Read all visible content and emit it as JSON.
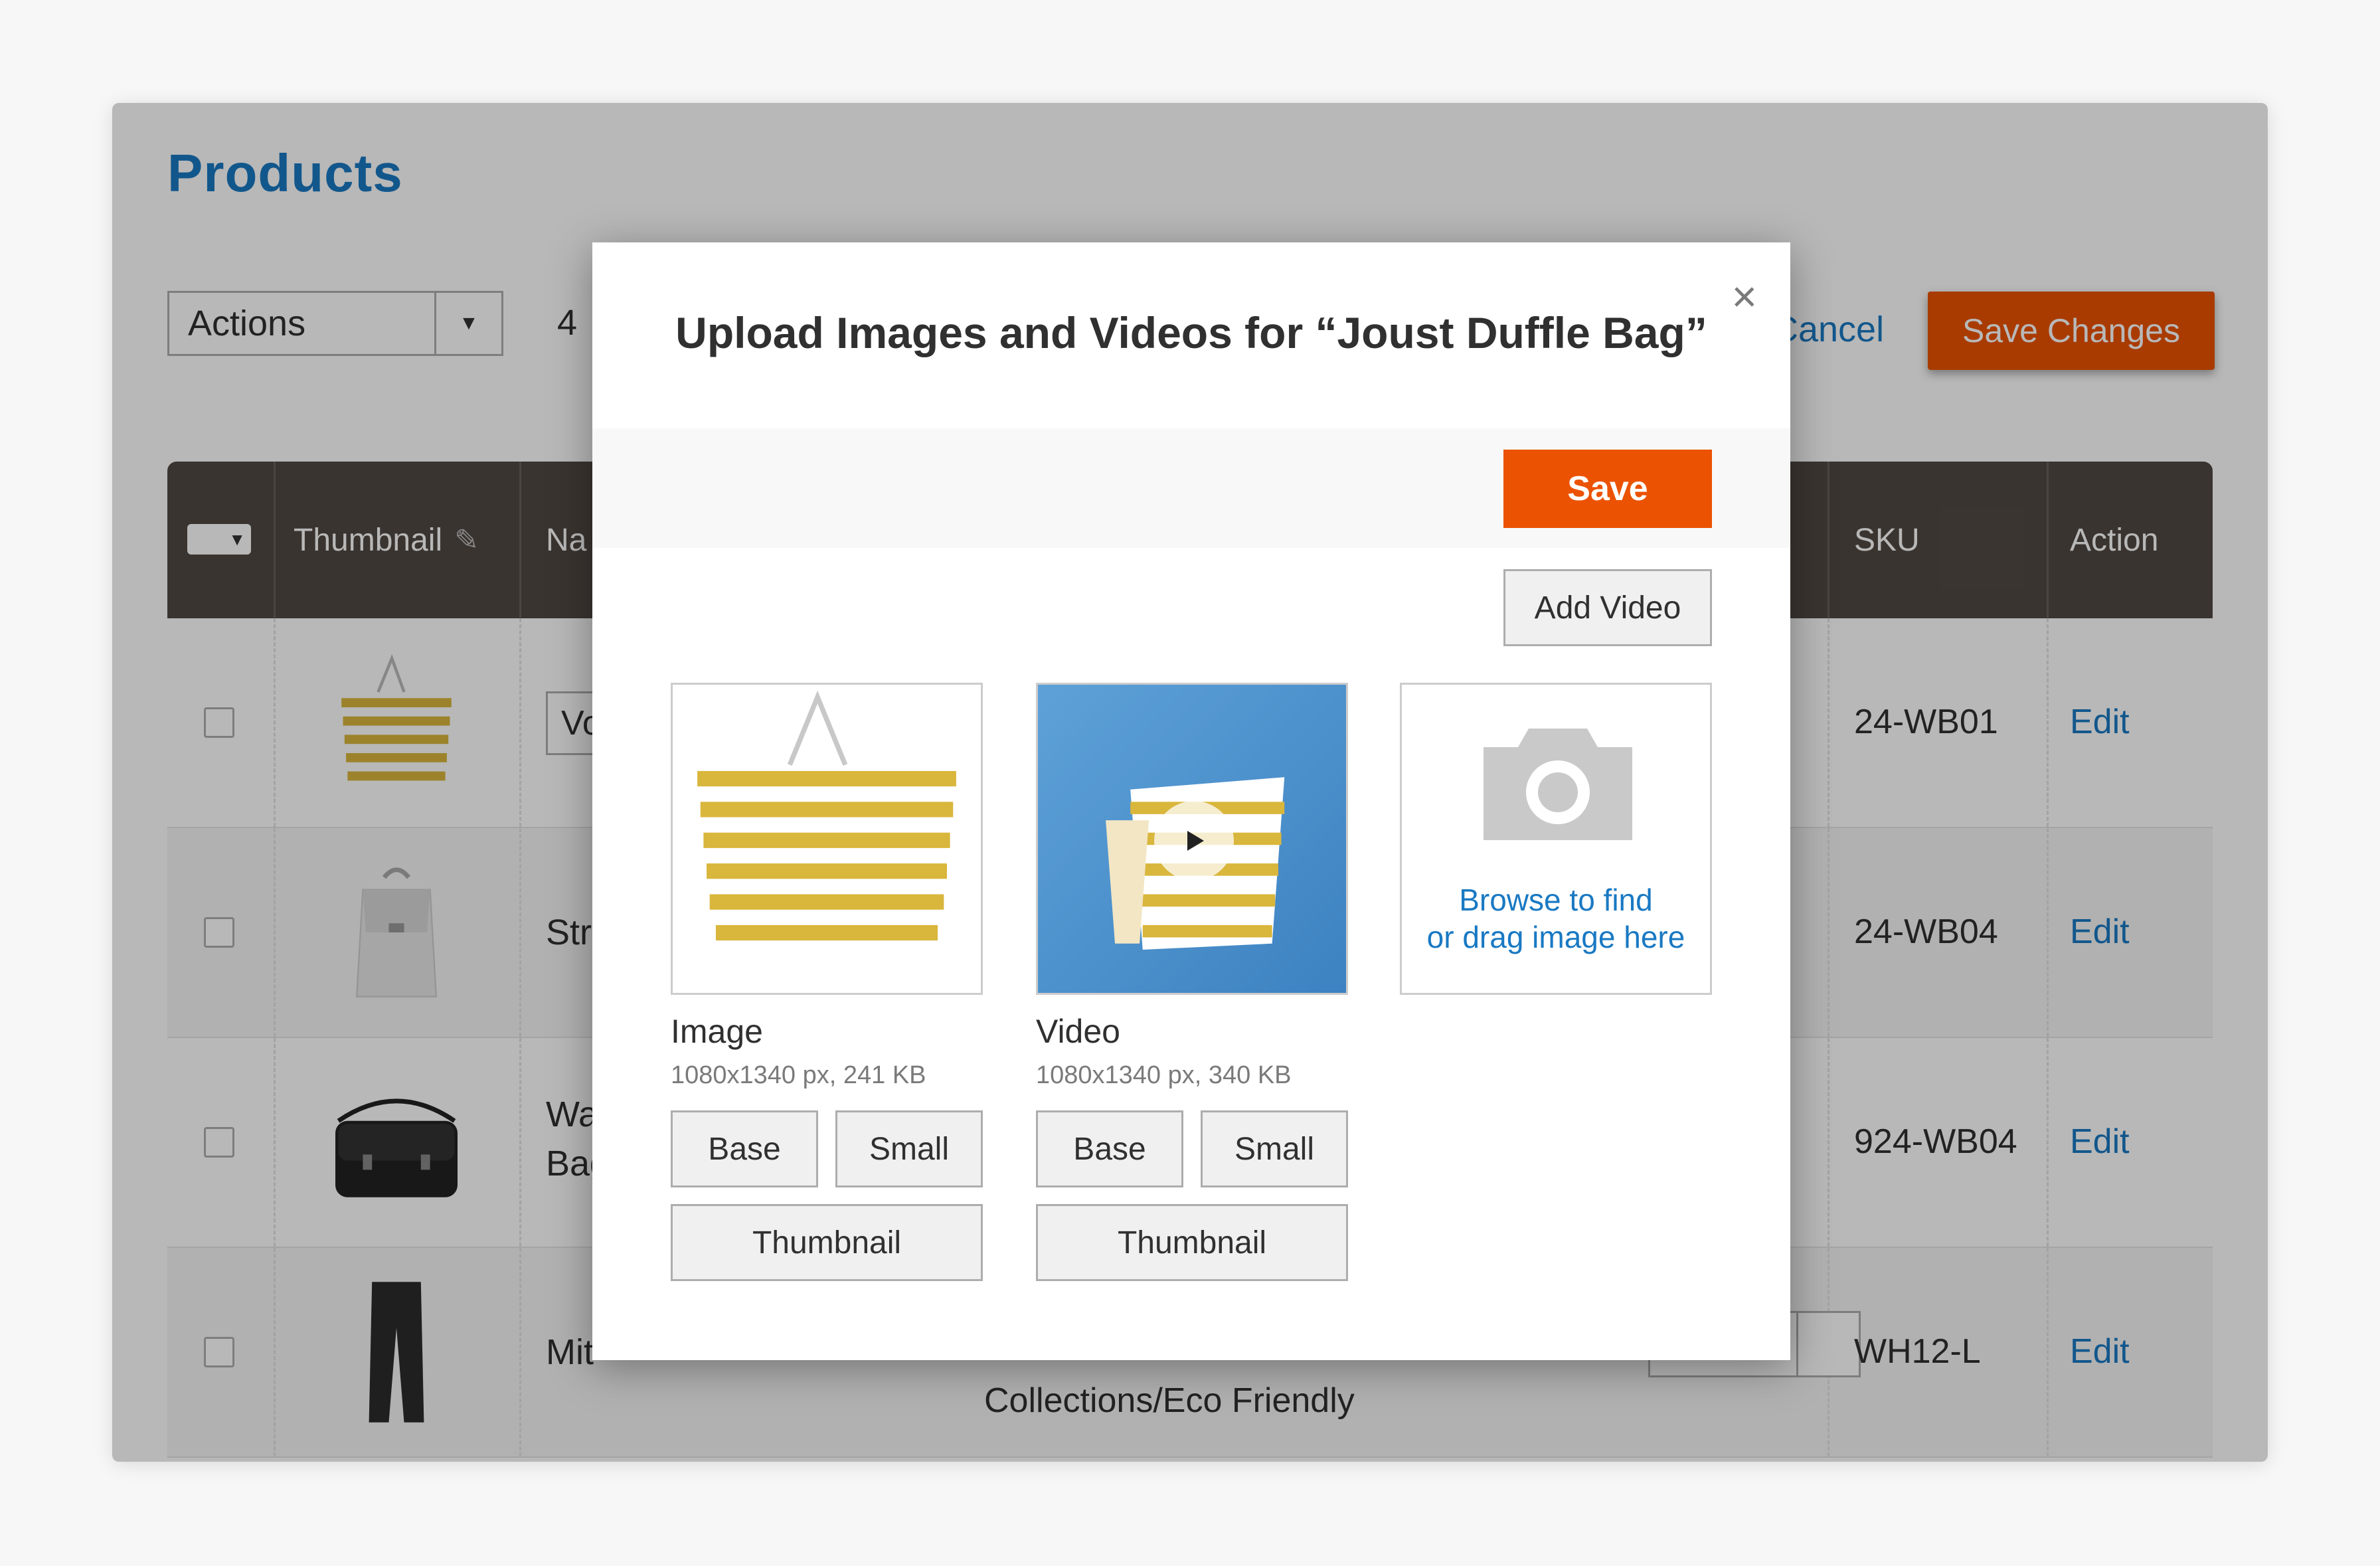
{
  "page": {
    "title": "Products",
    "actions_select": "Actions",
    "records_count": "4",
    "cancel": "Cancel",
    "save_changes": "Save Changes"
  },
  "grid": {
    "columns": {
      "thumbnail": "Thumbnail",
      "name": "Na",
      "sku": "SKU",
      "action": "Action"
    },
    "rows": [
      {
        "name": "Vo",
        "sku": "24-WB01",
        "action": "Edit"
      },
      {
        "name": "Str",
        "sku": "24-WB04",
        "action": "Edit"
      },
      {
        "name_line1": "Wa",
        "name_line2": "Bag",
        "sku": "924-WB04",
        "action": "Edit"
      },
      {
        "name": "Mit",
        "extra": "Collections/Eco Friendly",
        "sku": "WH12-L",
        "action": "Edit"
      }
    ]
  },
  "modal": {
    "title": "Upload Images and Videos for  “Joust Duffle Bag”",
    "save": "Save",
    "add_video": "Add Video",
    "items": [
      {
        "label": "Image",
        "meta": "1080x1340 px, 241 KB",
        "roles": [
          "Base",
          "Small",
          "Thumbnail"
        ]
      },
      {
        "label": "Video",
        "meta": "1080x1340 px, 340 KB",
        "roles": [
          "Base",
          "Small",
          "Thumbnail"
        ]
      }
    ],
    "upload": {
      "line1": "Browse to find",
      "line2": "or drag image here"
    }
  },
  "colors": {
    "accent": "#eb5202",
    "link": "#1979c3",
    "grid_header": "#514943"
  }
}
